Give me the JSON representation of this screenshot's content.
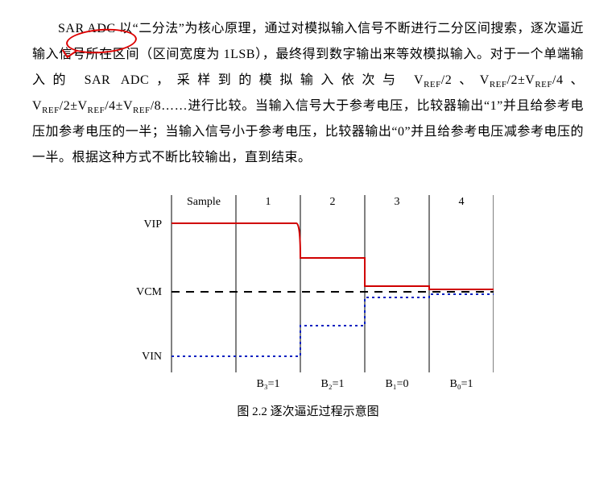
{
  "paragraph": {
    "p1a": "SAR ADC 以“二分法”为核心原理，通过对模拟输入信号不断进行二分区间搜索，逐次逼近输入信号所在区间（区间宽度为 1LSB），最终得到数字输出来等效模拟输入。对于一个单端输入的 SAR ADC，采样到的模拟输入依次与 V",
    "ref": "REF",
    "p1b": "/2、V",
    "p1c": "/2±V",
    "p1d": "/4、V",
    "p1e": "/2±V",
    "p1f": "/4±V",
    "p1g": "/8……进行比较。当输入信号大于参考电压，比较器输出“1”并且给参考电压加参考电压的一半；当输入信号小于参考电压，比较器输出“0”并且给参考电压减参考电压的一半。根据这种方式不断比较输出，直到结束。"
  },
  "figure": {
    "caption": "图 2.2 逐次逼近过程示意图",
    "columns": [
      "Sample",
      "1",
      "2",
      "3",
      "4"
    ],
    "y_labels": [
      "VIP",
      "VCM",
      "VIN"
    ],
    "bits": [
      "B₃=1",
      "B₂=1",
      "B₁=0",
      "B₀=1"
    ]
  },
  "chart_data": {
    "type": "line",
    "title": "逐次逼近过程示意图",
    "xlabel": "",
    "ylabel": "",
    "x_columns": [
      "Sample",
      "1",
      "2",
      "3",
      "4"
    ],
    "y_levels": {
      "VIP": 1.0,
      "VCM": 0.0,
      "VIN": -1.0
    },
    "series": [
      {
        "name": "VIP (red solid)",
        "color": "#d00000",
        "style": "solid",
        "segments": [
          {
            "col": "Sample",
            "level": 1.0
          },
          {
            "col": "1",
            "level": 1.0
          },
          {
            "col": "2",
            "level": 0.5
          },
          {
            "col": "3",
            "level": 0.08
          },
          {
            "col": "4",
            "level": 0.04
          }
        ]
      },
      {
        "name": "VIN (blue dotted)",
        "color": "#0020c0",
        "style": "dotted",
        "segments": [
          {
            "col": "Sample",
            "level": -1.0
          },
          {
            "col": "1",
            "level": -1.0
          },
          {
            "col": "2",
            "level": -0.5
          },
          {
            "col": "3",
            "level": -0.08
          },
          {
            "col": "4",
            "level": -0.04
          }
        ]
      },
      {
        "name": "VCM (black dashed)",
        "color": "#000000",
        "style": "dashed",
        "constant_level": 0.0
      }
    ],
    "bit_outputs": {
      "B3": 1,
      "B2": 1,
      "B1": 0,
      "B0": 1
    }
  }
}
